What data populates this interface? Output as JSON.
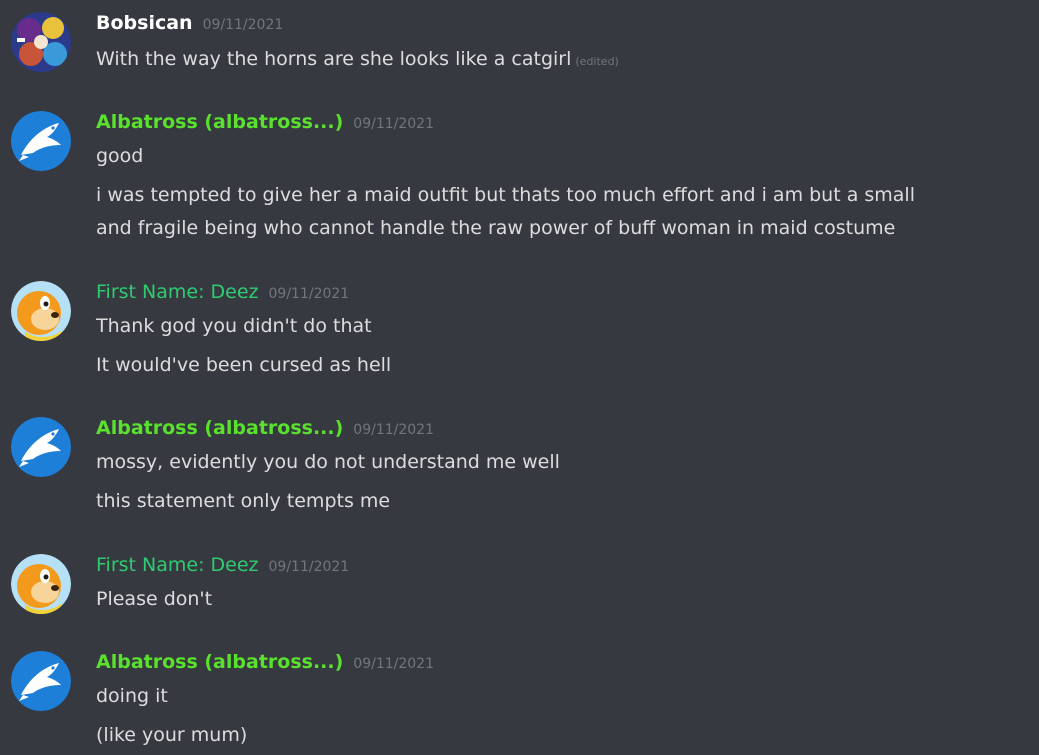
{
  "colors": {
    "background": "#36393f",
    "text": "#dcddde",
    "timestamp": "#72767d",
    "albatross_name": "#59e12e",
    "deez_name": "#2ecc71"
  },
  "messages": [
    {
      "author": "Bobsican",
      "timestamp": "09/11/2021",
      "avatar": "collage-avatar",
      "lines": [
        "With the way the horns are she looks like a catgirl"
      ],
      "edited": "(edited)"
    },
    {
      "author": "Albatross (albatross...)",
      "timestamp": "09/11/2021",
      "avatar": "blue-dolphin-avatar",
      "lines": [
        "good",
        "i was tempted to give her a maid outfit but thats too much effort and i am but a small",
        "and fragile being who cannot handle the raw power of buff woman in maid costume"
      ]
    },
    {
      "author": "First Name: Deez",
      "timestamp": "09/11/2021",
      "avatar": "orange-character-avatar",
      "lines": [
        "Thank god you didn't do that",
        "It would've been cursed as hell"
      ]
    },
    {
      "author": "Albatross (albatross...)",
      "timestamp": "09/11/2021",
      "avatar": "blue-dolphin-avatar",
      "lines": [
        "mossy, evidently you do not understand me well",
        "this statement only tempts me"
      ]
    },
    {
      "author": "First Name: Deez",
      "timestamp": "09/11/2021",
      "avatar": "orange-character-avatar",
      "lines": [
        "Please don't"
      ]
    },
    {
      "author": "Albatross (albatross...)",
      "timestamp": "09/11/2021",
      "avatar": "blue-dolphin-avatar",
      "lines": [
        "doing it",
        "(like your mum)"
      ]
    }
  ]
}
